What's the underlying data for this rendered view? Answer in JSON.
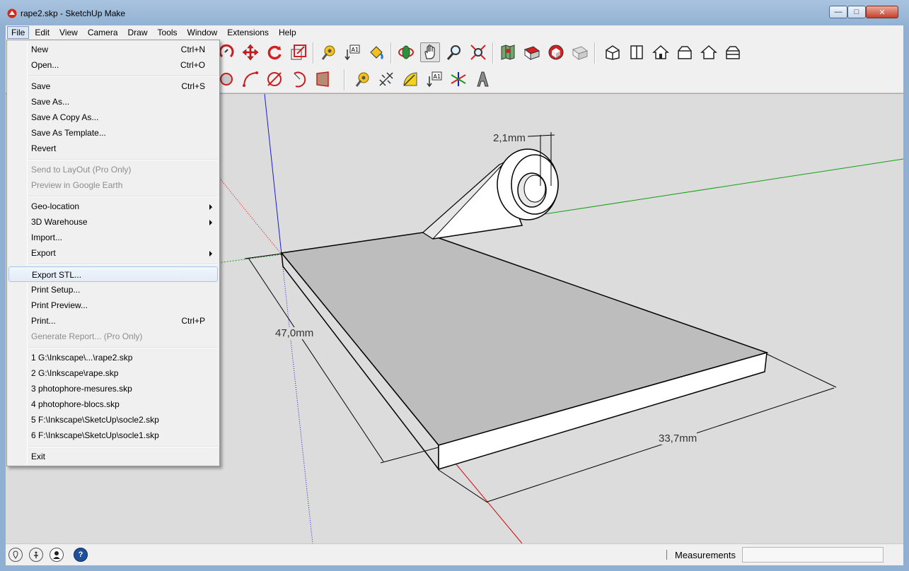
{
  "window": {
    "title": "rape2.skp - SketchUp Make",
    "controls": {
      "minimize": "—",
      "maximize": "□",
      "close": "✕"
    }
  },
  "menubar": {
    "items": [
      "File",
      "Edit",
      "View",
      "Camera",
      "Draw",
      "Tools",
      "Window",
      "Extensions",
      "Help"
    ],
    "active": "File"
  },
  "file_menu": {
    "items": [
      {
        "label": "New",
        "shortcut": "Ctrl+N"
      },
      {
        "label": "Open...",
        "shortcut": "Ctrl+O"
      },
      {
        "label": "Save",
        "shortcut": "Ctrl+S"
      },
      {
        "label": "Save As...",
        "shortcut": ""
      },
      {
        "label": "Save A Copy As...",
        "shortcut": ""
      },
      {
        "label": "Save As Template...",
        "shortcut": ""
      },
      {
        "label": "Revert",
        "shortcut": ""
      },
      {
        "label": "Send to LayOut (Pro Only)",
        "shortcut": "",
        "disabled": true
      },
      {
        "label": "Preview in Google Earth",
        "shortcut": "",
        "disabled": true
      },
      {
        "label": "Geo-location",
        "submenu": true
      },
      {
        "label": "3D Warehouse",
        "submenu": true
      },
      {
        "label": "Import...",
        "shortcut": ""
      },
      {
        "label": "Export",
        "submenu": true
      },
      {
        "label": "Export STL...",
        "shortcut": "",
        "highlighted": true
      },
      {
        "label": "Print Setup...",
        "shortcut": ""
      },
      {
        "label": "Print Preview...",
        "shortcut": ""
      },
      {
        "label": "Print...",
        "shortcut": "Ctrl+P"
      },
      {
        "label": "Generate Report... (Pro Only)",
        "shortcut": "",
        "disabled": true
      },
      {
        "label": "1 G:\\Inkscape\\...\\rape2.skp",
        "shortcut": ""
      },
      {
        "label": "2 G:\\Inkscape\\rape.skp",
        "shortcut": ""
      },
      {
        "label": "3 photophore-mesures.skp",
        "shortcut": ""
      },
      {
        "label": "4 photophore-blocs.skp",
        "shortcut": ""
      },
      {
        "label": "5 F:\\Inkscape\\SketcUp\\socle2.skp",
        "shortcut": ""
      },
      {
        "label": "6 F:\\Inkscape\\SketcUp\\socle1.skp",
        "shortcut": ""
      },
      {
        "label": "Exit",
        "shortcut": ""
      }
    ]
  },
  "toolbar": {
    "row1_icons": [
      "orbit-partial-icon",
      "move-icon",
      "rotate-icon",
      "scale-icon",
      "tape-measure-icon",
      "text-icon",
      "paint-bucket-icon",
      "orbit-icon",
      "pan-icon",
      "zoom-icon",
      "zoom-extents-icon",
      "add-location-icon",
      "photo-textures-icon",
      "3d-warehouse-icon",
      "share-model-icon",
      "iso-view-icon",
      "top-view-icon",
      "front-view-icon",
      "right-view-icon",
      "back-view-icon",
      "left-view-icon"
    ],
    "row2_icons": [
      "circle-icon",
      "arc-icon",
      "pie-icon",
      "arc-2pt-icon",
      "follow-me-icon",
      "tape-icon",
      "dimension-icon",
      "protractor-icon",
      "text-label-icon",
      "axes-icon",
      "3d-text-icon"
    ],
    "pressed": "pan-icon"
  },
  "viewport": {
    "dimensions": [
      {
        "label": "2,1mm"
      },
      {
        "label": "47,0mm"
      },
      {
        "label": "33,7mm"
      }
    ],
    "colors": {
      "background": "#dcdcdc",
      "top_face": "#bdbdbd",
      "side_face": "#ffffff",
      "red_axis": "#d40000",
      "green_axis": "#12a012",
      "blue_axis": "#1a1ad8"
    }
  },
  "statusbar": {
    "icons": [
      "geo-location-icon",
      "credits-icon",
      "user-icon",
      "help-icon"
    ],
    "help_glyph": "?",
    "measurements_label": "Measurements",
    "measurements_value": ""
  }
}
